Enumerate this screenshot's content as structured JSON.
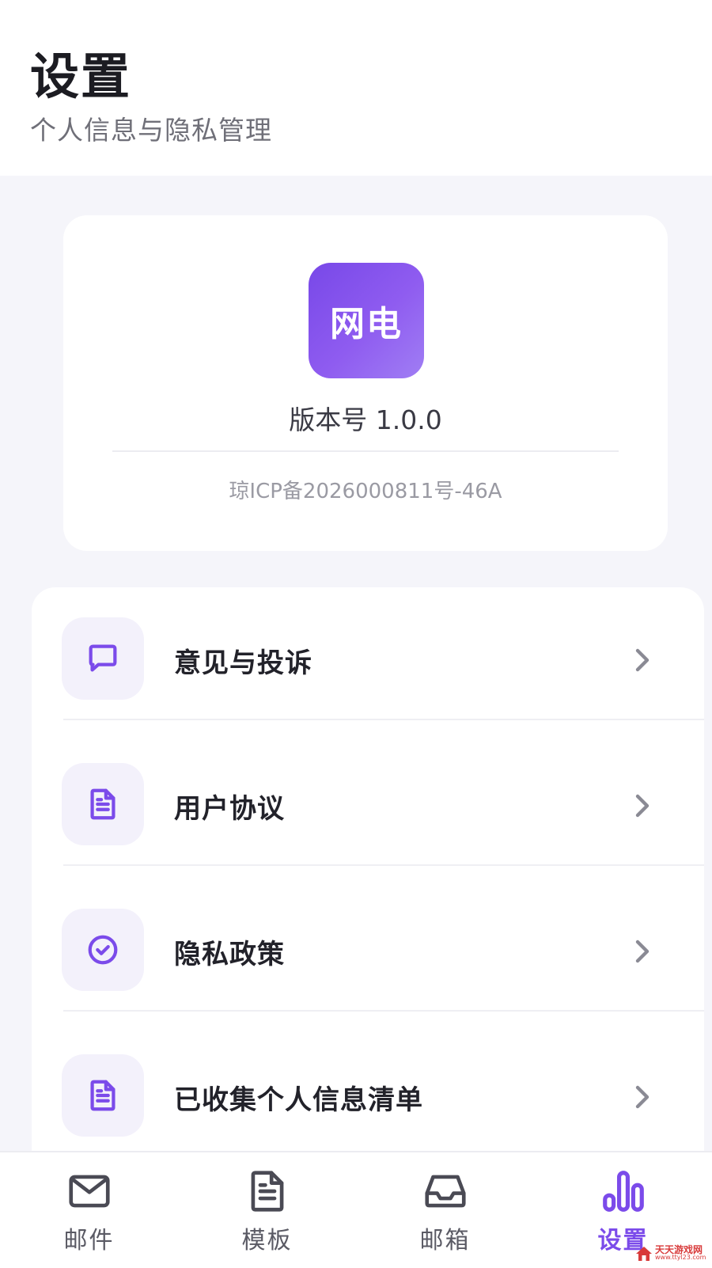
{
  "header": {
    "title": "设置",
    "subtitle": "个人信息与隐私管理"
  },
  "info_card": {
    "logo_text": "网电",
    "version": "版本号 1.0.0",
    "icp": "琼ICP备2026000811号-46A"
  },
  "menu": {
    "items": [
      {
        "label": "意见与投诉",
        "icon": "chat-bubble-icon"
      },
      {
        "label": "用户协议",
        "icon": "document-icon"
      },
      {
        "label": "隐私政策",
        "icon": "check-circle-icon"
      },
      {
        "label": "已收集个人信息清单",
        "icon": "document-icon"
      }
    ]
  },
  "bottom_nav": {
    "items": [
      {
        "label": "邮件",
        "icon": "mail-icon",
        "active": false
      },
      {
        "label": "模板",
        "icon": "document-icon",
        "active": false
      },
      {
        "label": "邮箱",
        "icon": "inbox-icon",
        "active": false
      },
      {
        "label": "设置",
        "icon": "bar-chart-icon",
        "active": true
      }
    ]
  },
  "watermark": {
    "text": "天天游戏网",
    "sub": "www.ttyl23.com"
  },
  "colors": {
    "accent": "#7b4bea",
    "icon_bg": "#f3f1fb",
    "background": "#f5f5fa"
  }
}
